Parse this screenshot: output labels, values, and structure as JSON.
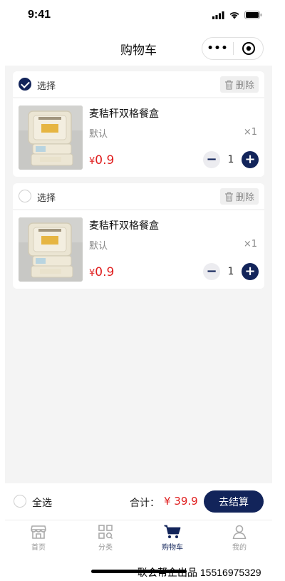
{
  "status_bar": {
    "time": "9:41"
  },
  "nav": {
    "title": "购物车"
  },
  "cart": {
    "items": [
      {
        "checked": true,
        "select_label": "选择",
        "delete_label": "删除",
        "name": "麦秸秆双格餐盒",
        "spec": "默认",
        "count": "×1",
        "currency": "¥",
        "price": "0.9",
        "quantity": "1"
      },
      {
        "checked": false,
        "select_label": "选择",
        "delete_label": "删除",
        "name": "麦秸秆双格餐盒",
        "spec": "默认",
        "count": "×1",
        "currency": "¥",
        "price": "0.9",
        "quantity": "1"
      }
    ]
  },
  "summary": {
    "select_all_label": "全选",
    "total_label": "合计：",
    "total_value": "¥ 39.9",
    "checkout_label": "去结算"
  },
  "tabbar": {
    "items": [
      {
        "label": "首页",
        "icon": "store-icon",
        "active": false
      },
      {
        "label": "分类",
        "icon": "category-icon",
        "active": false
      },
      {
        "label": "购物车",
        "icon": "cart-icon",
        "active": true
      },
      {
        "label": "我的",
        "icon": "user-icon",
        "active": false
      }
    ]
  },
  "credit": "联会帮企出品 15516975329",
  "colors": {
    "accent": "#12245a",
    "price": "#e02020",
    "background": "#f4f4f4"
  }
}
